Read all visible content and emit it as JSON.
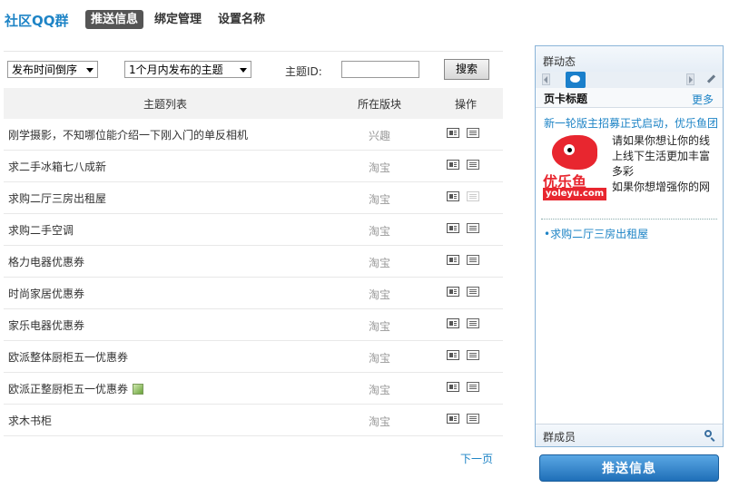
{
  "header": {
    "brand": "社区QQ群",
    "tabs": [
      {
        "label": "推送信息",
        "active": true
      },
      {
        "label": "绑定管理",
        "active": false
      },
      {
        "label": "设置名称",
        "active": false
      }
    ]
  },
  "filters": {
    "sort_value": "发布时间倒序",
    "range_value": "1个月内发布的主题",
    "topic_id_label": "主题ID:",
    "topic_id_value": "",
    "search_label": "搜索"
  },
  "table": {
    "headers": [
      "主题列表",
      "所在版块",
      "操作"
    ],
    "rows": [
      {
        "title": "刚学摄影，不知哪位能介绍一下刚入门的单反相机",
        "section": "兴趣",
        "has_image": false,
        "list_dim": false
      },
      {
        "title": "求二手冰箱七八成新",
        "section": "淘宝",
        "has_image": false,
        "list_dim": false
      },
      {
        "title": "求购二厅三房出租屋",
        "section": "淘宝",
        "has_image": false,
        "list_dim": true
      },
      {
        "title": "求购二手空调",
        "section": "淘宝",
        "has_image": false,
        "list_dim": false
      },
      {
        "title": "格力电器优惠券",
        "section": "淘宝",
        "has_image": false,
        "list_dim": false
      },
      {
        "title": "时尚家居优惠券",
        "section": "淘宝",
        "has_image": false,
        "list_dim": false
      },
      {
        "title": "家乐电器优惠券",
        "section": "淘宝",
        "has_image": false,
        "list_dim": false
      },
      {
        "title": "欧派整体厨柜五一优惠券",
        "section": "淘宝",
        "has_image": false,
        "list_dim": false
      },
      {
        "title": "欧派正整厨柜五一优惠券",
        "section": "淘宝",
        "has_image": true,
        "list_dim": false
      },
      {
        "title": "求木书柜",
        "section": "淘宝",
        "has_image": false,
        "list_dim": false
      }
    ],
    "next_label": "下一页"
  },
  "panel": {
    "title": "群动态",
    "section_title": "页卡标题",
    "more_label": "更多",
    "promo_link": "新一轮版主招募正式启动，优乐鱼团",
    "logo_name": "优乐鱼",
    "logo_domain": "yoleyu.com",
    "desc_lines": [
      "请如果你想让你的线",
      "上线下生活更加丰富",
      "多彩",
      "如果你想增强你的网"
    ],
    "bullet_link": "•求购二厅三房出租屋",
    "members_label": "群成员"
  },
  "push_button_label": "推送信息",
  "colors": {
    "accent": "#1e84c6",
    "logo_red": "#e8262f",
    "button_blue": "#2a7cc6"
  }
}
